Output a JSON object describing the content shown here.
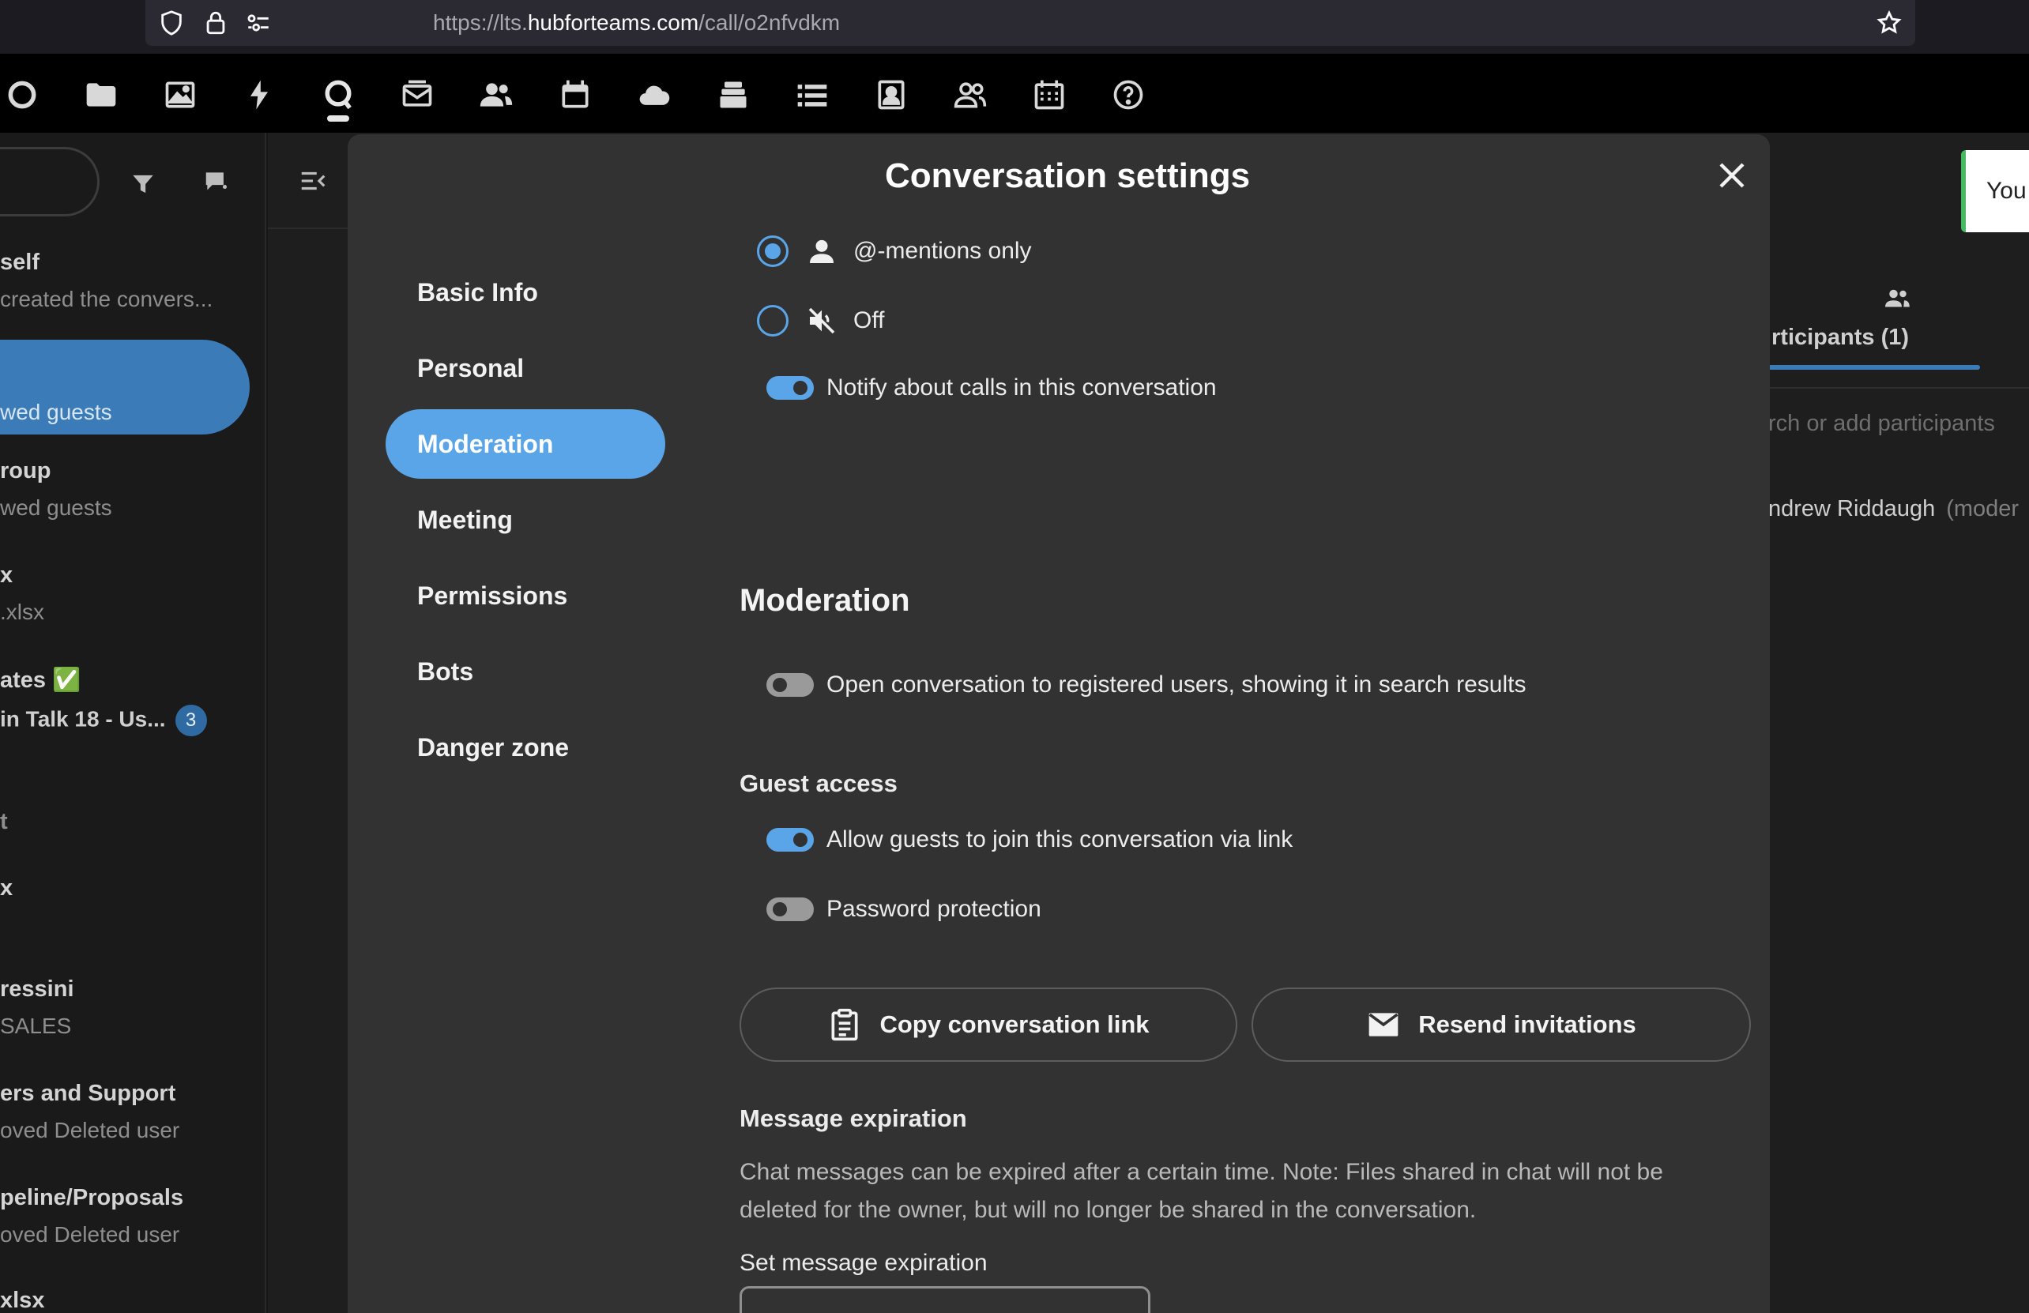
{
  "browser": {
    "url_prefix": "https://lts.",
    "url_host": "hubforteams.com",
    "url_path": "/call/o2nfvdkm"
  },
  "app_header": {
    "icons": [
      "dashboard-icon",
      "files-icon",
      "photos-icon",
      "activity-icon",
      "talk-icon",
      "mail-icon",
      "contacts-icon",
      "calendar-icon",
      "cloud-icon",
      "deck-icon",
      "tasks-icon",
      "user-card-icon",
      "circles-icon",
      "appointments-icon",
      "help-icon"
    ]
  },
  "left_nav": {
    "conversations": [
      {
        "title": "self",
        "subtitle": "created the convers..."
      },
      {
        "title": "",
        "subtitle": "wed guests"
      },
      {
        "title": "roup",
        "subtitle": "wed guests"
      },
      {
        "title": "x",
        "subtitle": ".xlsx"
      },
      {
        "title": "ates ✅",
        "subtitle": "in Talk 18 - Us...",
        "badge": "3"
      },
      {
        "title": "t",
        "subtitle": ""
      },
      {
        "title": "x",
        "subtitle": ""
      },
      {
        "title": "ressini",
        "subtitle": "SALES"
      },
      {
        "title": "ers and Support",
        "subtitle": "oved Deleted user"
      },
      {
        "title": "peline/Proposals",
        "subtitle": "oved Deleted user"
      },
      {
        "title": "xlsx",
        "subtitle": ""
      }
    ]
  },
  "right_panel": {
    "toast": "You",
    "participants_tab": "rticipants (1)",
    "search_placeholder": "rch or add participants",
    "participant_name": "ndrew Riddaugh",
    "participant_role": "(moder"
  },
  "modal": {
    "title": "Conversation settings",
    "nav": [
      "Basic Info",
      "Personal",
      "Moderation",
      "Meeting",
      "Permissions",
      "Bots",
      "Danger zone"
    ],
    "active_nav": "Moderation",
    "notifications": {
      "mentions_label": "@-mentions only",
      "off_label": "Off",
      "notify_calls_label": "Notify about calls in this conversation"
    },
    "moderation": {
      "heading": "Moderation",
      "open_conversation_label": "Open conversation to registered users, showing it in search results"
    },
    "guest_access": {
      "heading": "Guest access",
      "allow_guests_label": "Allow guests to join this conversation via link",
      "password_label": "Password protection",
      "copy_link_label": "Copy conversation link",
      "resend_label": "Resend invitations"
    },
    "message_expiration": {
      "heading": "Message expiration",
      "description": "Chat messages can be expired after a certain time. Note: Files shared in chat will not be deleted for the owner, but will no longer be shared in the conversation.",
      "set_label": "Set message expiration"
    }
  },
  "colors": {
    "accent": "#5aa5e8",
    "modal_bg": "#323232",
    "header_bg": "#000000"
  }
}
